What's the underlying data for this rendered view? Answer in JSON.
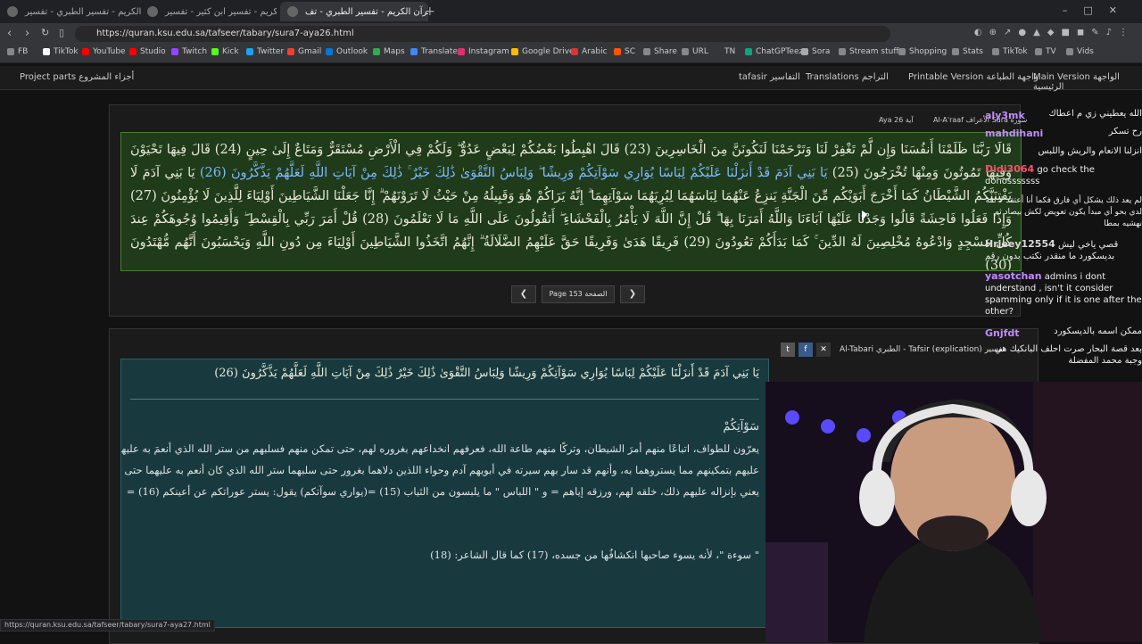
{
  "browser": {
    "tabs": [
      {
        "title": "القرآن الكريم - تفسير الطبري - تفسير..."
      },
      {
        "title": "القرآن الكريم - تفسير ابن كثير - تفسير..."
      },
      {
        "title": "القرآن الكريم - تفسير الطبري - تف..."
      }
    ],
    "url": "https://quran.ksu.edu.sa/tafseer/tabary/sura7-aya26.html",
    "bookmarks": [
      "FB",
      "TikTok",
      "YouTube",
      "Studio",
      "Twitch",
      "Kick",
      "Twitter",
      "Gmail",
      "Outlook",
      "Maps",
      "Translate",
      "Instagram",
      "Google Drive",
      "Arabic",
      "SC",
      "Share",
      "URL",
      "TN",
      "ChatGPTeez",
      "Sora",
      "Stream stuff",
      "Shopping",
      "Stats",
      "TikTok",
      "TV",
      "Vids"
    ],
    "status_url": "https://quran.ksu.edu.sa/tafseer/tabary/sura7-aya27.html"
  },
  "site_nav": {
    "project_parts": "Project parts أجزاء المشروع",
    "tafasir": "tafasir التفاسير",
    "translations": "Translations التراجم",
    "printable": "Printable Version واجهة الطباعة",
    "main_version": "Main Version الواجهة الرئيسية"
  },
  "selectors": {
    "aya": "Aya 26 آية",
    "sura": "Al-A'raaf الأعراف Sura سورة",
    "page": "Page 153 الصفحة",
    "tafsir": "Al-Tabari الطبري - Tafsir (explication) تفسير"
  },
  "verses": {
    "text_a": "قَالَا رَبَّنَا ظَلَمْنَا أَنفُسَنَا وَإِن لَّمْ تَغْفِرْ لَنَا وَتَرْحَمْنَا لَنَكُونَنَّ مِنَ الْخَاسِرِينَ (23) قَالَ اهْبِطُوا بَعْضُكُمْ لِبَعْضٍ عَدُوٌّ ۖ وَلَكُمْ فِي الْأَرْضِ مُسْتَقَرٌّ وَمَتَاعٌ إِلَىٰ حِينٍ (24) قَالَ فِيهَا تَحْيَوْنَ وَفِيهَا تَمُوتُونَ وَمِنْهَا تُخْرَجُونَ (25)",
    "text_b": "يَا بَنِي آدَمَ قَدْ أَنزَلْنَا عَلَيْكُمْ لِبَاسًا يُوَارِي سَوْآتِكُمْ وَرِيشًا ۖ وَلِبَاسُ التَّقْوَىٰ ذَٰلِكَ خَيْرٌ ۚ ذَٰلِكَ مِنْ آيَاتِ اللَّهِ لَعَلَّهُمْ يَذَّكَّرُونَ (26)",
    "text_c": "يَا بَنِي آدَمَ لَا يَفْتِنَنَّكُمُ الشَّيْطَانُ كَمَا أَخْرَجَ أَبَوَيْكُم مِّنَ الْجَنَّةِ يَنزِعُ عَنْهُمَا لِبَاسَهُمَا لِيُرِيَهُمَا سَوْآتِهِمَا ۗ إِنَّهُ يَرَاكُمْ هُوَ وَقَبِيلُهُ مِنْ حَيْثُ لَا تَرَوْنَهُمْ ۗ إِنَّا جَعَلْنَا الشَّيَاطِينَ أَوْلِيَاءَ لِلَّذِينَ لَا يُؤْمِنُونَ (27) وَإِذَا فَعَلُوا فَاحِشَةً قَالُوا وَجَدْنَا عَلَيْهَا آبَاءَنَا وَاللَّهُ أَمَرَنَا بِهَا ۗ قُلْ إِنَّ اللَّهَ لَا يَأْمُرُ بِالْفَحْشَاءِ ۖ أَتَقُولُونَ عَلَى اللَّهِ مَا لَا تَعْلَمُونَ (28) قُلْ أَمَرَ رَبِّي بِالْقِسْطِ ۖ وَأَقِيمُوا وُجُوهَكُمْ عِندَ كُلِّ مَسْجِدٍ وَادْعُوهُ مُخْلِصِينَ لَهُ الدِّينَ ۚ كَمَا بَدَأَكُمْ تَعُودُونَ (29) فَرِيقًا هَدَىٰ وَفَرِيقًا حَقَّ عَلَيْهِمُ الضَّلَالَةُ ۗ إِنَّهُمُ اتَّخَذُوا الشَّيَاطِينَ أَوْلِيَاءَ مِن دُونِ اللَّهِ وَيَحْسَبُونَ أَنَّهُم مُّهْتَدُونَ (30)"
  },
  "tafsir": {
    "heading": "يَا بَنِي آدَمَ قَدْ أَنزَلْنَا عَلَيْكُمْ لِبَاسًا يُوَارِي سَوْآتِكُمْ وَرِيشًا وَلِبَاسُ التَّقْوَىٰ ذَٰلِكَ خَيْرٌ ذَٰلِكَ مِنْ آيَاتِ اللَّهِ لَعَلَّهُمْ يَذَّكَّرُونَ (26)",
    "line1": "سَوْآتِكُمْ",
    "line2": "يعرّون للطواف، اتباعًا منهم أمرَ الشيطان، وتركًا منهم طاعة الله، فعرفهم انخداعهم بغروره لهم، حتى تمكن منهم فسلبهم من ستر الله الذي أنعمَ به عليهم،",
    "line3": "عليهم بتمكينهم مما يستروهما به، وأنهم قد سار بهم سيرته في أبويهم آدم وحواء اللذين دلاهما بغرور حتى سلبهما ستر الله الذي كان أنعم به عليهما حتى أبدى",
    "line4": "يعني بإنزاله عليهم ذلك، خلقه لهم، ورزقه إياهم = و \" اللباس \" ما يلبسون من الثياب (15) =(يواري سوآتكم) يقول: يستر عوراتكم عن أعينكم (16) =",
    "line5": "\" سوءة \"، لأنه يسوء صاحبها انكشافُها من جسده، (17) كما قال الشاعر: (18)"
  },
  "chat": [
    {
      "user": "",
      "text": "الله يعطيني زي م اعطاك"
    },
    {
      "user": "aly3mk",
      "text": "رح تسكر"
    },
    {
      "user": "mahdihani",
      "text": ""
    },
    {
      "user": "",
      "text": "انزلنا الانعام والريش واللبس"
    },
    {
      "user": "Didi3064",
      "text": "go check the donosssssss"
    },
    {
      "user": "",
      "text": "لم يعد ذلك يشكل أي فارق فكما أنا أعتقد لا ثقة لدي بحو أي مبدأ يكون تعويض لكش بيصاد ثم نهشيه بمطا"
    },
    {
      "user": "Hrleey12554",
      "text": "قصي ياخي ليش بديسكورد ما منقدر نكتب بدون رقم"
    },
    {
      "user": "yasotchan",
      "text": "admins i dont understand , isn't it consider spamming only if it is one after the other?"
    },
    {
      "user": "",
      "text": "ممكن اسمه بالديسكورد"
    },
    {
      "user": "Gnjfdt",
      "text": ""
    },
    {
      "user": "",
      "text": "بعد قصة البحار صرت احلف البانكيك هي وجبة محمد المفضلة"
    }
  ],
  "colors": {
    "verse_bg": "#1f3b1a",
    "tafsir_bg": "#183a3f",
    "link_blue": "#7fb8ff",
    "chat_user": "#c08cff"
  }
}
